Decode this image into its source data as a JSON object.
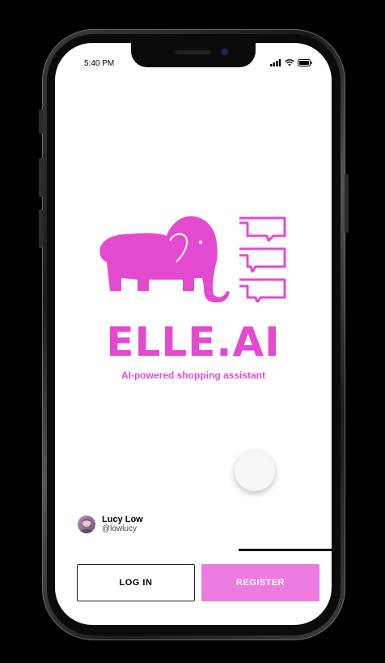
{
  "status_bar": {
    "time": "5:40 PM",
    "icons": [
      "signal-icon",
      "wifi-icon",
      "battery-icon"
    ]
  },
  "logo": {
    "brand_name": "ELLE.AI",
    "tagline": "AI-powered shopping assistant",
    "graphic_icons": [
      "elephant-icon",
      "chat-bubble-icon"
    ]
  },
  "user": {
    "name": "Lucy Low",
    "handle": "@lowlucy"
  },
  "actions": {
    "login_label": "LOG IN",
    "register_label": "REGISTER"
  },
  "colors": {
    "brand_pink": "#e44ad0",
    "register_button": "#ec7ce0"
  }
}
